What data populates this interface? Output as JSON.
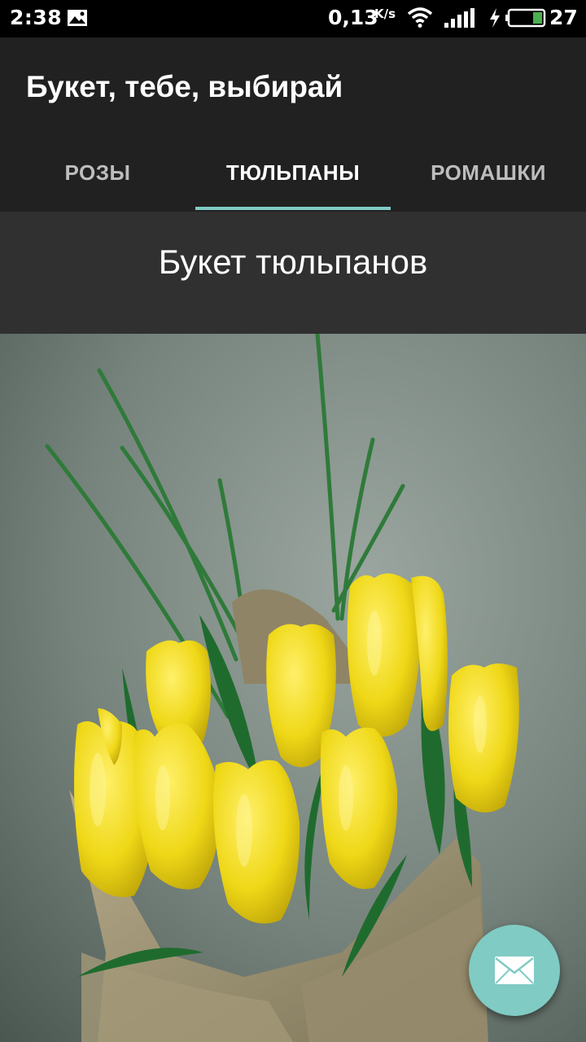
{
  "status_bar": {
    "time": "2:38",
    "network_speed": "0,13",
    "network_speed_unit": "K/s",
    "battery_level": "27",
    "icons": [
      "gallery-icon",
      "wifi-icon",
      "signal-icon",
      "charging-icon",
      "battery-icon"
    ]
  },
  "app_bar": {
    "title": "Букет, тебе, выбирай"
  },
  "tabs": [
    {
      "label": "РОЗЫ",
      "active": false
    },
    {
      "label": "ТЮЛЬПАНЫ",
      "active": true
    },
    {
      "label": "РОМАШКИ",
      "active": false
    }
  ],
  "content": {
    "title": "Букет тюльпанов",
    "image_subject": "bouquet of yellow tulips wrapped in kraft paper"
  },
  "fab": {
    "icon": "mail-icon"
  },
  "colors": {
    "status_bar": "#000000",
    "app_bar": "#212121",
    "content_header": "#303030",
    "accent": "#80cbc4",
    "tulip_yellow": "#f2dd18"
  }
}
